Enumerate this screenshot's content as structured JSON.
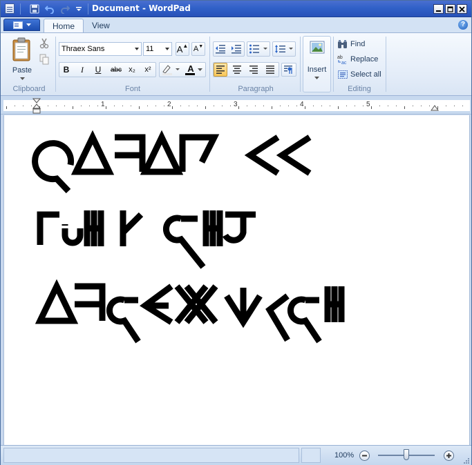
{
  "window": {
    "title": "Document - WordPad"
  },
  "tabs": [
    {
      "label": "Home",
      "active": true
    },
    {
      "label": "View",
      "active": false
    }
  ],
  "clipboard": {
    "paste_label": "Paste",
    "group_label": "Clipboard"
  },
  "font": {
    "family": "Thraex Sans",
    "size": "11",
    "group_label": "Font",
    "buttons": {
      "bold": "B",
      "italic": "I",
      "underline": "U",
      "strike": "abc",
      "subscript": "x₂",
      "superscript": "x²",
      "grow": "A",
      "shrink": "A",
      "color": "A"
    }
  },
  "paragraph": {
    "group_label": "Paragraph"
  },
  "insert": {
    "label": "Insert"
  },
  "editing": {
    "group_label": "Editing",
    "find": "Find",
    "replace": "Replace",
    "select_all": "Select all"
  },
  "ruler": {
    "numbers": [
      "1",
      "2",
      "3",
      "4",
      "5"
    ]
  },
  "status": {
    "zoom": "100%"
  },
  "colors": {
    "titlebar": "#3161c8",
    "accent_active": "#f8c75a",
    "ribbon": "#e3ecf8"
  }
}
